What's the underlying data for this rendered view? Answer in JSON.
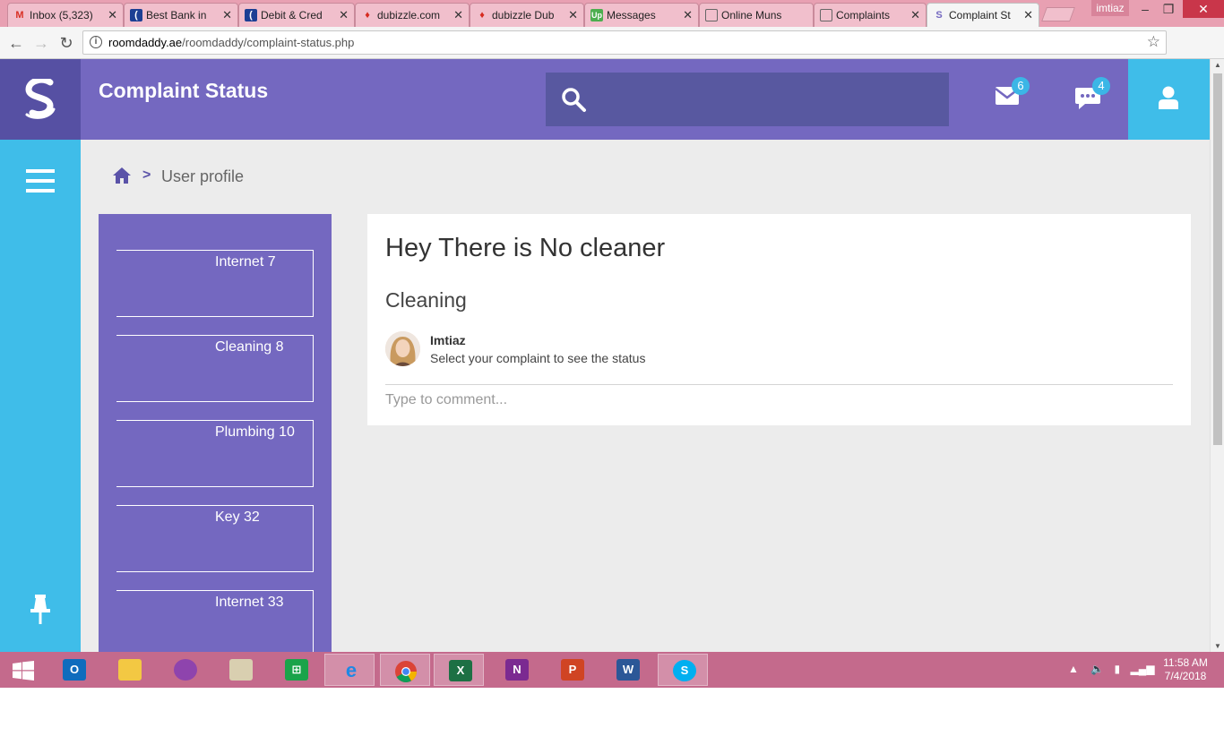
{
  "browser": {
    "tabs": [
      {
        "label": "Inbox (5,323)",
        "icon": "gmail-icon"
      },
      {
        "label": "Best Bank in",
        "icon": "bank-icon"
      },
      {
        "label": "Debit & Cred",
        "icon": "bank-icon"
      },
      {
        "label": "dubizzle.com",
        "icon": "dubizzle-icon"
      },
      {
        "label": "dubizzle Dub",
        "icon": "dubizzle-icon"
      },
      {
        "label": "Messages",
        "icon": "upwork-icon"
      },
      {
        "label": "Online Muns",
        "icon": "page-icon"
      },
      {
        "label": "Complaints",
        "icon": "page-icon"
      },
      {
        "label": "Complaint St",
        "icon": "site-logo-icon",
        "active": true
      }
    ],
    "window_user": "imtiaz",
    "url_domain": "roomdaddy.ae",
    "url_path": "/roomdaddy/complaint-status.php"
  },
  "header": {
    "title": "Complaint Status",
    "search_placeholder": "",
    "mail_count": "6",
    "chat_count": "4"
  },
  "breadcrumb": {
    "current": "User profile"
  },
  "complaints": [
    {
      "label": "Internet 7"
    },
    {
      "label": "Cleaning 8"
    },
    {
      "label": "Plumbing 10"
    },
    {
      "label": "Key 32"
    },
    {
      "label": "Internet 33"
    }
  ],
  "detail": {
    "title": "Hey There is No cleaner",
    "category": "Cleaning",
    "commenter": "Imtiaz",
    "comment_text": "Select your complaint to see the status",
    "comment_placeholder": "Type to comment..."
  },
  "taskbar": {
    "apps": [
      "windows-start",
      "outlook",
      "file-explorer",
      "picasa",
      "scanner",
      "store",
      "internet-explorer",
      "chrome",
      "excel",
      "onenote",
      "powerpoint",
      "word",
      "skype"
    ],
    "time": "11:58 AM",
    "date": "7/4/2018"
  },
  "colors": {
    "header_purple": "#7468c0",
    "logo_purple": "#5650a3",
    "sidebar_blue": "#3fbde9",
    "background": "#ececec"
  }
}
